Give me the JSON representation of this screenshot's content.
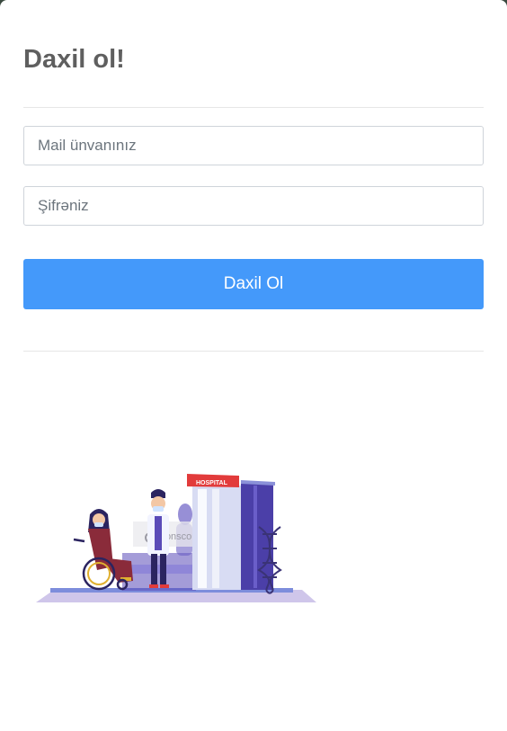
{
  "login": {
    "title": "Daxil ol!",
    "email_placeholder": "Mail ünvanınız",
    "password_placeholder": "Şifrəniz",
    "submit_label": "Daxil Ol"
  },
  "illustration": {
    "sign_text": "HOSPITAL",
    "watermark": "iconscout"
  },
  "colors": {
    "primary": "#4499fa",
    "title": "#5f5f5f",
    "hospital_sign": "#e23b3b",
    "building": "#4b3fa8"
  }
}
